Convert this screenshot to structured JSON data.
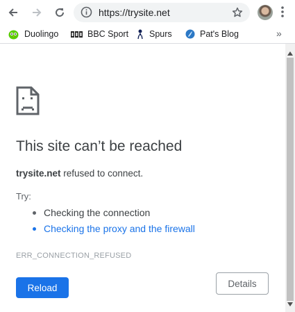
{
  "toolbar": {
    "url": "https://trysite.net",
    "icons": [
      "back-icon",
      "forward-icon",
      "reload-icon",
      "info-icon",
      "star-icon",
      "menu-icon"
    ]
  },
  "bookmarks": [
    {
      "label": "Duolingo",
      "icon": "duolingo-icon"
    },
    {
      "label": "BBC Sport",
      "icon": "bbc-icon"
    },
    {
      "label": "Spurs",
      "icon": "spurs-icon"
    },
    {
      "label": "Pat's Blog",
      "icon": "blog-icon"
    }
  ],
  "bookmarks_more": "»",
  "error_page": {
    "title": "This site can’t be reached",
    "host": "trysite.net",
    "summary_rest": " refused to connect.",
    "try_label": "Try:",
    "suggestions": [
      "Checking the connection",
      "Checking the proxy and the firewall"
    ],
    "error_code": "ERR_CONNECTION_REFUSED",
    "reload_label": "Reload",
    "details_label": "Details"
  },
  "colors": {
    "accent": "#1a73e8",
    "link": "#1a73e8",
    "text": "#3c4043"
  }
}
